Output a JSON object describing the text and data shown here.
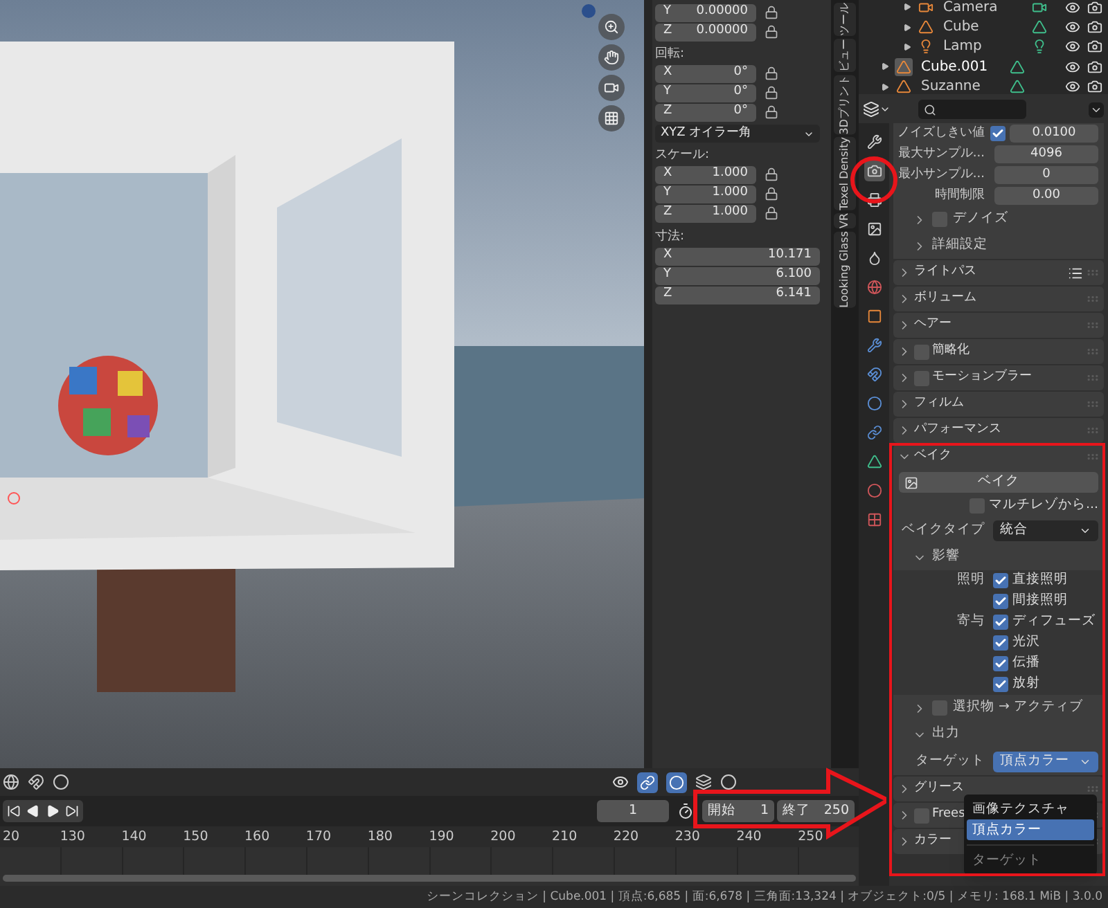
{
  "sidebar_panel": {
    "location_rows": [
      {
        "axis": "Y",
        "value": "0.00000"
      },
      {
        "axis": "Z",
        "value": "0.00000"
      }
    ],
    "rotation": {
      "label": "回転:",
      "rows": [
        {
          "axis": "X",
          "value": "0°"
        },
        {
          "axis": "Y",
          "value": "0°"
        },
        {
          "axis": "Z",
          "value": "0°"
        }
      ],
      "mode": "XYZ オイラー角"
    },
    "scale": {
      "label": "スケール:",
      "rows": [
        {
          "axis": "X",
          "value": "1.000"
        },
        {
          "axis": "Y",
          "value": "1.000"
        },
        {
          "axis": "Z",
          "value": "1.000"
        }
      ]
    },
    "dimensions": {
      "label": "寸法:",
      "rows": [
        {
          "axis": "X",
          "value": "10.171"
        },
        {
          "axis": "Y",
          "value": "6.100"
        },
        {
          "axis": "Z",
          "value": "6.141"
        }
      ]
    }
  },
  "sidebar_tabs": [
    {
      "label": "ツール"
    },
    {
      "label": "ビュー"
    },
    {
      "label": "3Dプリント"
    },
    {
      "label": "Texel Density"
    },
    {
      "label": "VR"
    },
    {
      "label": "Looking Glass"
    }
  ],
  "outliner": {
    "items": [
      {
        "children": [
          {
            "name": "Camera",
            "kind": "camera",
            "selected": false
          },
          {
            "name": "Cube",
            "kind": "mesh",
            "selected": false
          },
          {
            "name": "Lamp",
            "kind": "light",
            "selected": false
          }
        ]
      },
      {
        "name": "Cube.001",
        "kind": "mesh",
        "selected": true
      },
      {
        "name": "Suzanne",
        "kind": "mesh",
        "selected": false
      }
    ]
  },
  "properties": {
    "tabs": [
      {
        "kind": "tool",
        "selected": false
      },
      {
        "kind": "render",
        "selected": true
      },
      {
        "kind": "output",
        "selected": false
      },
      {
        "kind": "view_layer",
        "selected": false
      },
      {
        "kind": "scene",
        "selected": false
      },
      {
        "kind": "world",
        "selected": false
      },
      {
        "kind": "object",
        "selected": false
      },
      {
        "kind": "modifier",
        "selected": false
      },
      {
        "kind": "particles",
        "selected": false
      },
      {
        "kind": "physics",
        "selected": false
      },
      {
        "kind": "constraints",
        "selected": false
      },
      {
        "kind": "data",
        "selected": false
      },
      {
        "kind": "material",
        "selected": false
      },
      {
        "kind": "texture",
        "selected": false
      }
    ],
    "rows": [
      {
        "kind": "check_field",
        "label": "ノイズしきい値",
        "checked": true,
        "value": "0.0100"
      },
      {
        "kind": "field",
        "label": "最大サンプル...",
        "value": "4096"
      },
      {
        "kind": "field",
        "label": "最小サンプル...",
        "value": "0"
      },
      {
        "kind": "field",
        "label": "時間制限",
        "value": "0.00"
      },
      {
        "kind": "subpanel",
        "label": "デノイズ",
        "expanded": false,
        "checked": false
      },
      {
        "kind": "subpanel",
        "label": "詳細設定",
        "expanded": false
      },
      {
        "kind": "panel",
        "label": "ライトパス",
        "expanded": false,
        "presets": true
      },
      {
        "kind": "panel",
        "label": "ボリューム",
        "expanded": false
      },
      {
        "kind": "panel",
        "label": "ヘアー",
        "expanded": false
      },
      {
        "kind": "panel",
        "label": "簡略化",
        "expanded": false,
        "checked": false
      },
      {
        "kind": "panel",
        "label": "モーションブラー",
        "expanded": false,
        "checked": false
      },
      {
        "kind": "panel",
        "label": "フィルム",
        "expanded": false
      },
      {
        "kind": "panel",
        "label": "パフォーマンス",
        "expanded": false
      },
      {
        "kind": "panel",
        "label": "ベイク",
        "expanded": true
      },
      {
        "kind": "button",
        "label": "ベイク"
      },
      {
        "kind": "checkbox",
        "label": "マルチレゾから...",
        "checked": false
      },
      {
        "kind": "dropdown",
        "label": "ベイクタイプ",
        "value": "統合",
        "open": false
      },
      {
        "kind": "subpanel",
        "label": "影響",
        "expanded": true
      },
      {
        "kind": "checkbox",
        "group": "照明",
        "label": "直接照明",
        "checked": true
      },
      {
        "kind": "checkbox",
        "label": "間接照明",
        "checked": true
      },
      {
        "kind": "checkbox",
        "group": "寄与",
        "label": "ディフューズ",
        "checked": true
      },
      {
        "kind": "checkbox",
        "label": "光沢",
        "checked": true
      },
      {
        "kind": "checkbox",
        "label": "伝播",
        "checked": true
      },
      {
        "kind": "checkbox",
        "label": "放射",
        "checked": true
      },
      {
        "kind": "subpanel",
        "label": "選択物 → アクティブ",
        "expanded": false,
        "checked": false
      },
      {
        "kind": "subpanel",
        "label": "出力",
        "expanded": true
      },
      {
        "kind": "dropdown",
        "label": "ターゲット",
        "value": "頂点カラー",
        "open": true
      },
      {
        "kind": "panel",
        "label": "グリース",
        "expanded": false
      },
      {
        "kind": "panel",
        "label": "Frees",
        "expanded": false,
        "checked": false
      },
      {
        "kind": "panel",
        "label": "カラー",
        "expanded": false
      }
    ]
  },
  "dropdown_menu": {
    "items": [
      {
        "label": "画像テクスチャ",
        "selected": false
      },
      {
        "label": "頂点カラー",
        "selected": true
      }
    ],
    "title": "ターゲット"
  },
  "timeline": {
    "current_frame": "1",
    "start_label": "開始",
    "start": "1",
    "end_label": "終了",
    "end": "250",
    "ruler": [
      "20",
      "130",
      "140",
      "150",
      "160",
      "170",
      "180",
      "190",
      "200",
      "210",
      "220",
      "230",
      "240",
      "250"
    ]
  },
  "status_bar": "シーンコレクション | Cube.001 | 頂点:6,685 | 面:6,678 | 三角面:13,324 | オブジェクト:0/5 | メモリ: 168.1 MiB | 3.0.0"
}
